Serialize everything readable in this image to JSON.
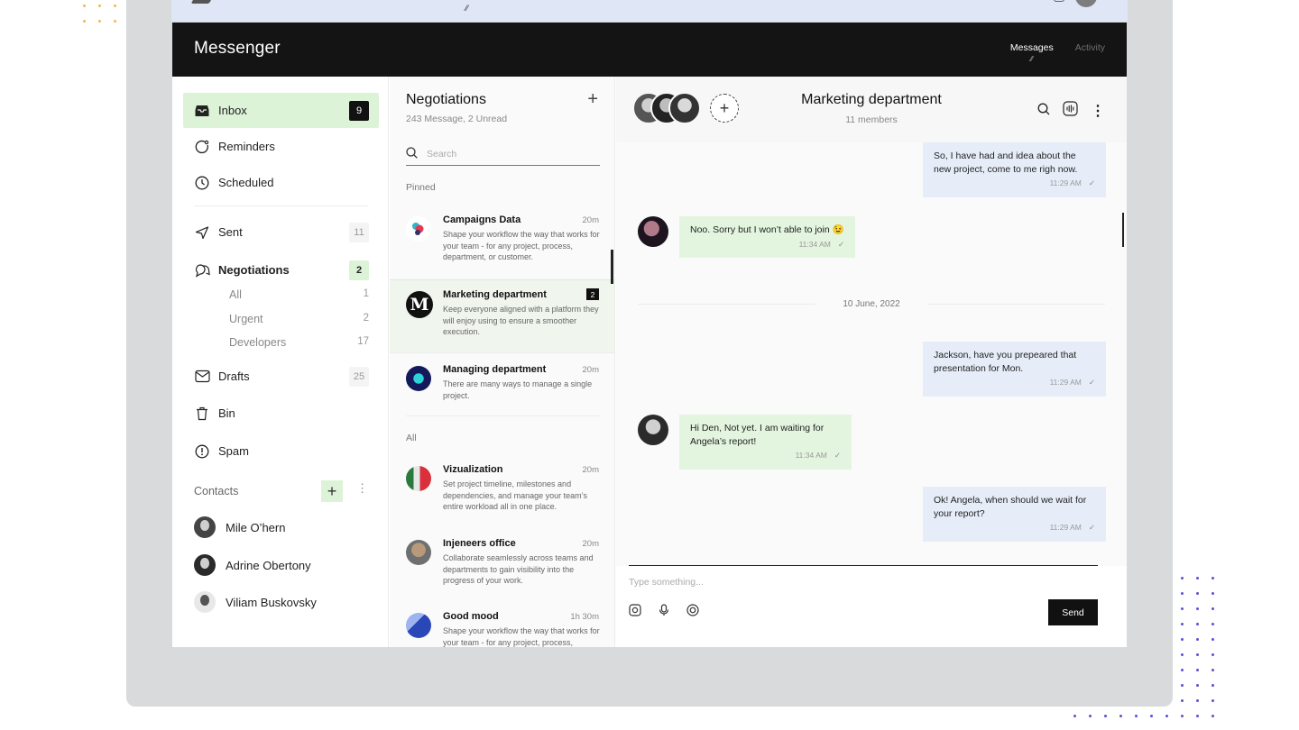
{
  "app": {
    "brand": "Messenger",
    "nav": [
      {
        "label": "Messages",
        "active": true
      },
      {
        "label": "Activity",
        "active": false
      }
    ]
  },
  "sidebar": {
    "items": [
      {
        "label": "Inbox",
        "icon": "inbox-icon",
        "count": "9"
      },
      {
        "label": "Reminders",
        "icon": "reminder-icon",
        "count": ""
      },
      {
        "label": "Scheduled",
        "icon": "clock-icon",
        "count": ""
      },
      {
        "label": "Sent",
        "icon": "send-icon",
        "count": "11"
      },
      {
        "label": "Negotiations",
        "icon": "chat-icon",
        "count": "2"
      },
      {
        "label": "Drafts",
        "icon": "drafts-icon",
        "count": "25"
      },
      {
        "label": "Bin",
        "icon": "trash-icon",
        "count": ""
      },
      {
        "label": "Spam",
        "icon": "alert-icon",
        "count": ""
      }
    ],
    "sub_items": [
      {
        "label": "All",
        "count": "1"
      },
      {
        "label": "Urgent",
        "count": "2"
      },
      {
        "label": "Developers",
        "count": "17"
      }
    ],
    "contacts_heading": "Contacts",
    "contacts": [
      "Mile O’hern",
      "Adrine Obertony",
      "Viliam Buskovsky"
    ]
  },
  "conversations": {
    "title": "Negotiations",
    "subtitle": "243 Message, 2 Unread",
    "search_placeholder": "Search",
    "pinned_label": "Pinned",
    "all_label": "All",
    "pinned": [
      {
        "name": "Campaigns Data",
        "time": "20m",
        "preview": "Shape your workflow the way that works for your team - for any project, process, department, or customer."
      },
      {
        "name": "Marketing department",
        "badge": "2",
        "preview": "Keep everyone aligned with a platform they will enjoy using to ensure a smoother execution."
      },
      {
        "name": "Managing department",
        "time": "20m",
        "preview": "There are many ways to manage a single project."
      }
    ],
    "all": [
      {
        "name": "Vizualization",
        "time": "20m",
        "preview": "Set project timeline, milestones and dependencies, and manage your team’s entire workload all in one place."
      },
      {
        "name": "Injeneers office",
        "time": "20m",
        "preview": "Collaborate seamlessly across teams and departments to gain visibility into the progress of your work."
      },
      {
        "name": "Good mood",
        "time": "1h 30m",
        "preview": "Shape your workflow the way that works for your team - for any project, process,"
      }
    ]
  },
  "chat": {
    "title": "Marketing department",
    "subtitle": "11 members",
    "date_separator": "10 June, 2022",
    "messages": [
      {
        "dir": "out",
        "text": "So, I have had and idea about the new project, come to me righ now.",
        "time": "11:29 AM"
      },
      {
        "dir": "in",
        "text": "Noo. Sorry but I won’t able to join 😉",
        "time": "11:34 AM"
      },
      {
        "dir": "out",
        "text": "Jackson, have you prepeared that presentation for Mon.",
        "time": "11:29 AM"
      },
      {
        "dir": "in",
        "text": "Hi Den, Not yet. I am waiting for Angela’s report!",
        "time": "11:34 AM"
      },
      {
        "dir": "out",
        "text": "Ok! Angela, when should we wait for your report?",
        "time": "11:29 AM"
      }
    ],
    "composer_placeholder": "Type something...",
    "send_label": "Send"
  },
  "colors": {
    "accent_green": "#ddf3d8",
    "bubble_out": "#e7edf8",
    "bubble_in": "#e3f5df",
    "dark": "#141414",
    "dots_orange": "#f2b84b",
    "dots_purple": "#5b4fd6"
  }
}
